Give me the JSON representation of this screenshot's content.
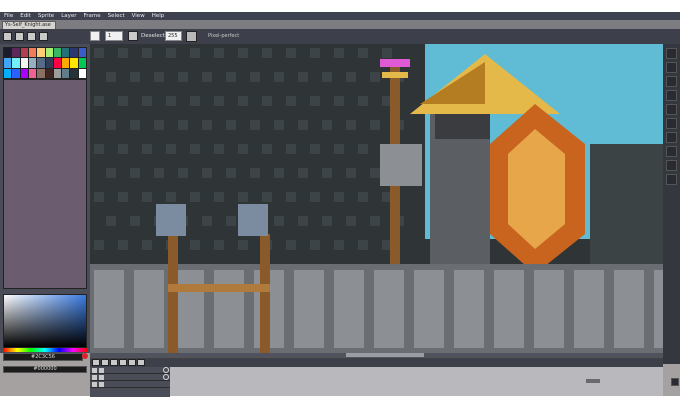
{
  "menu": [
    "File",
    "Edit",
    "Sprite",
    "Layer",
    "Frame",
    "Select",
    "View",
    "Help"
  ],
  "tab": {
    "title": "Ys-Self_Knight.ase"
  },
  "toolbar": {
    "brush_size": "1",
    "deselect_label": "Deselect",
    "deselect_value": "255",
    "pixel_perfect_label": "Pixel-perfect"
  },
  "palette_colors": [
    "#1a1c2c",
    "#5d275d",
    "#b13e53",
    "#ef7d57",
    "#ffcd75",
    "#a7f070",
    "#38b764",
    "#257179",
    "#29366f",
    "#3b5dc9",
    "#41a6f6",
    "#73eff7",
    "#f4f4f4",
    "#94b0c2",
    "#566c86",
    "#333c57",
    "#ff0044",
    "#ffaa00",
    "#ffe600",
    "#00c853",
    "#00b0ff",
    "#2962ff",
    "#aa00ff",
    "#f06292",
    "#8d6e63",
    "#3e2723",
    "#9e9e9e",
    "#607d8b",
    "#263238",
    "#ffffff"
  ],
  "color_fg": "#2C3C56",
  "color_bg": "#000000",
  "scene": {
    "sky": "#5fbcd4",
    "wall": "#2f3437",
    "wall_light": "#3c4447",
    "stone": "#6a6d72",
    "stone_light": "#8c8f94",
    "hat": "#e5b84a",
    "hat_dark": "#b57d22",
    "accent": "#e05ad6",
    "shield": "#c8641e",
    "shield_light": "#e7a64a",
    "wood": "#8a5a2b"
  }
}
